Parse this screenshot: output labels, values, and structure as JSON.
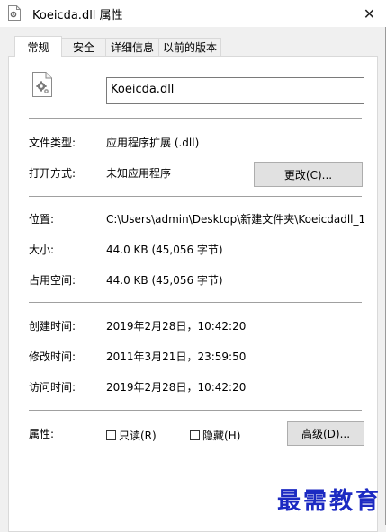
{
  "window": {
    "title": "Koeicda.dll 属性",
    "close_glyph": "✕"
  },
  "tabs": [
    {
      "label": "常规",
      "active": true
    },
    {
      "label": "安全",
      "active": false
    },
    {
      "label": "详细信息",
      "active": false
    },
    {
      "label": "以前的版本",
      "active": false
    }
  ],
  "general": {
    "file_name": "Koeicda.dll",
    "file_type_label": "文件类型:",
    "file_type_value": "应用程序扩展 (.dll)",
    "opens_with_label": "打开方式:",
    "opens_with_value": "未知应用程序",
    "change_button": "更改(C)...",
    "location_label": "位置:",
    "location_value": "C:\\Users\\admin\\Desktop\\新建文件夹\\Koeicdadll_1",
    "size_label": "大小:",
    "size_value": "44.0 KB (45,056 字节)",
    "size_on_disk_label": "占用空间:",
    "size_on_disk_value": "44.0 KB (45,056 字节)",
    "created_label": "创建时间:",
    "created_value": "2019年2月28日，10:42:20",
    "modified_label": "修改时间:",
    "modified_value": "2011年3月21日，23:59:50",
    "accessed_label": "访问时间:",
    "accessed_value": "2019年2月28日，10:42:20",
    "attributes_label": "属性:",
    "readonly_label": "只读(R)",
    "readonly_checked": false,
    "hidden_label": "隐藏(H)",
    "hidden_checked": false,
    "advanced_button": "高级(D)..."
  },
  "watermark": "最需教育",
  "colors": {
    "window_bg": "#f0f0f0",
    "panel_bg": "#ffffff",
    "button_bg": "#e1e1e1",
    "watermark": "#1c2ac2"
  },
  "icons": {
    "title_icon": "dll-file-gear-icon",
    "file_icon": "dll-file-gear-icon",
    "close": "close-icon"
  }
}
